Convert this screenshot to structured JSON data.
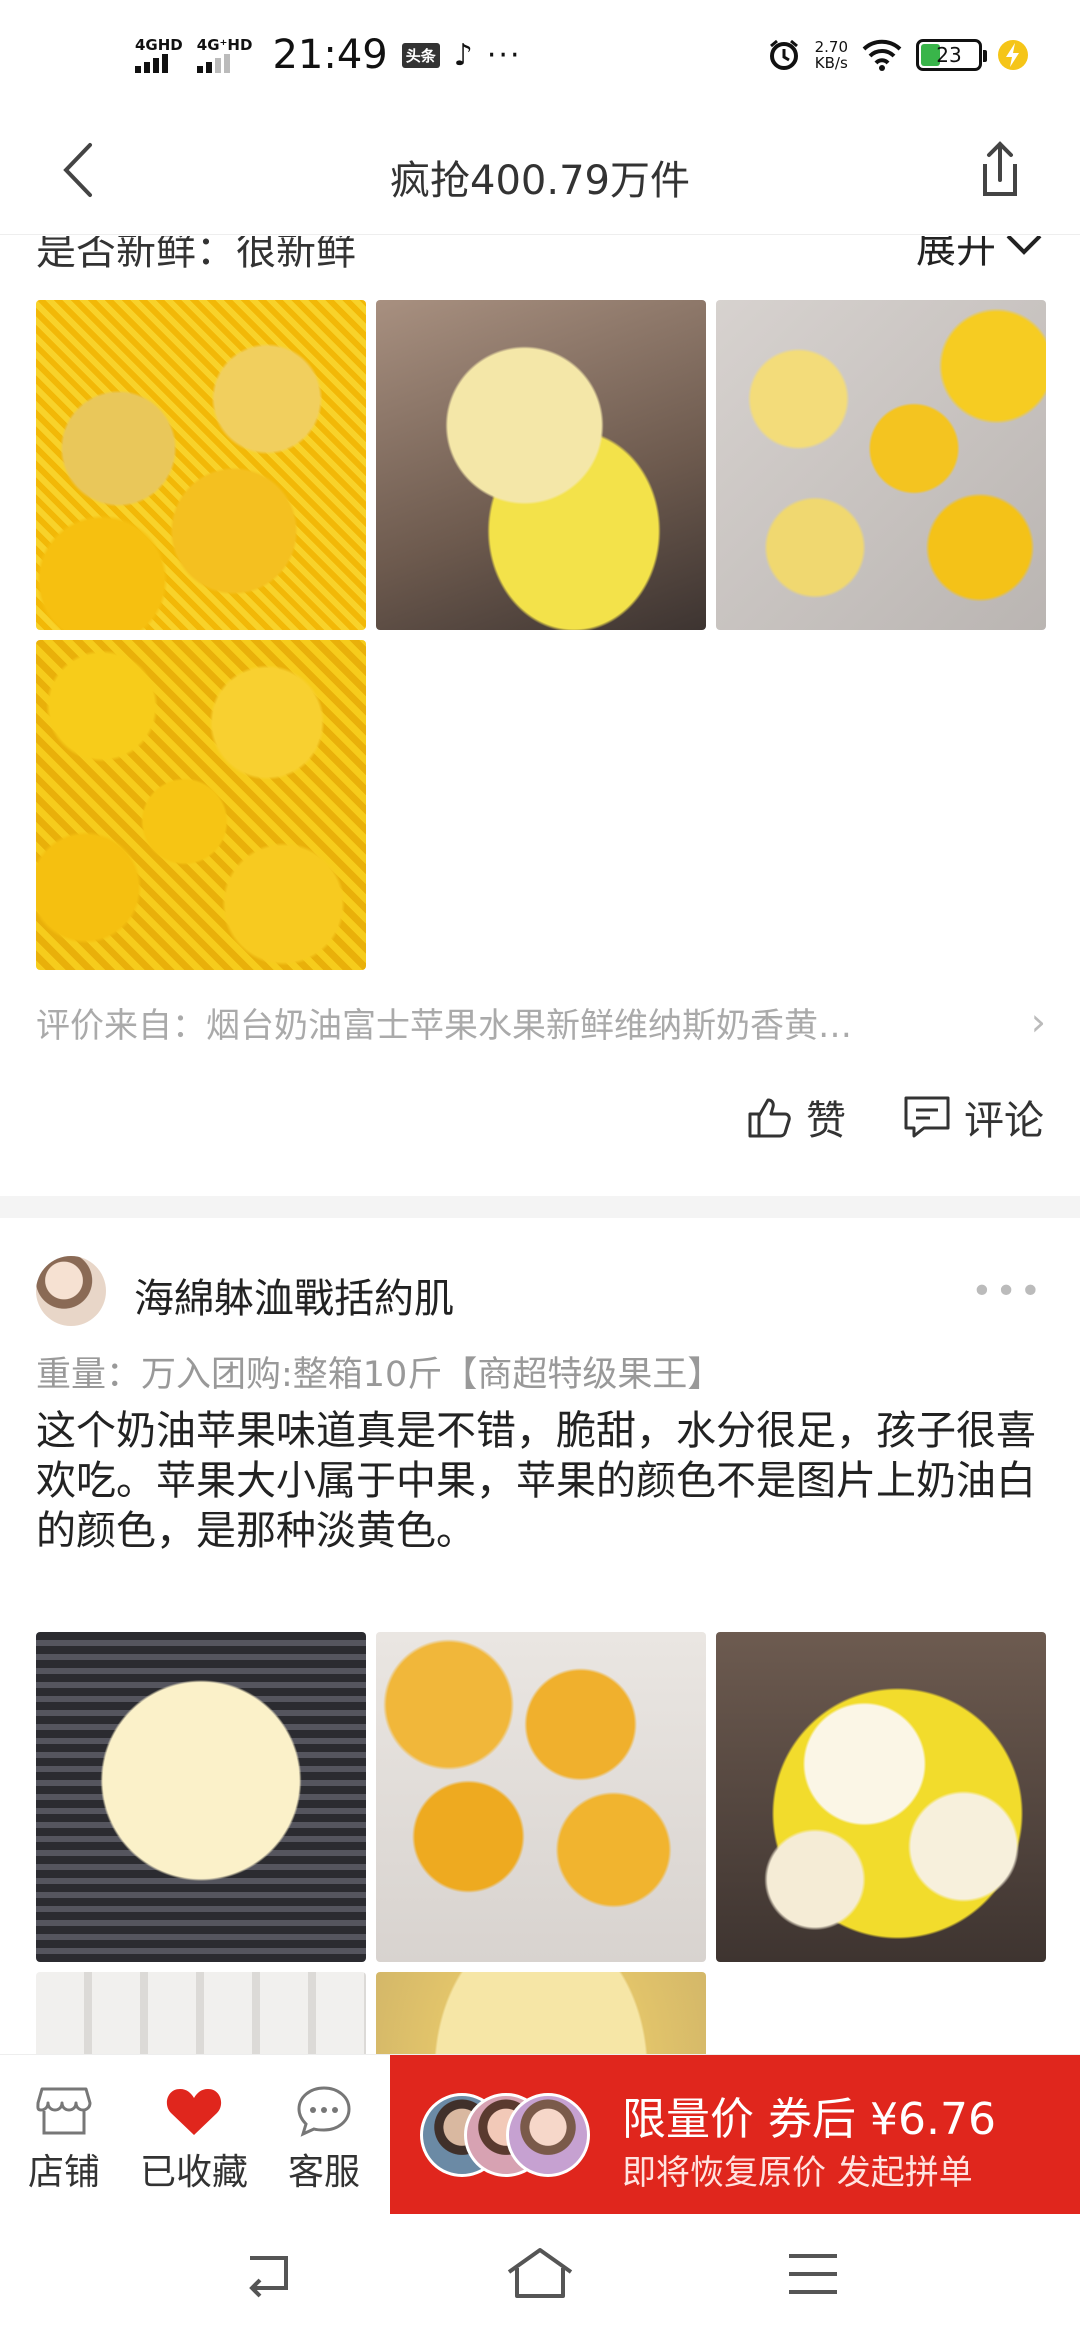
{
  "status_bar": {
    "sim1": "4GHD",
    "sim2": "4G⁺HD",
    "time": "21:49",
    "badge": "头条",
    "tiktok": "♪",
    "more": "···",
    "speed_value": "2.70",
    "speed_unit": "KB/s",
    "battery": "23"
  },
  "nav": {
    "title": "疯抢400.79万件"
  },
  "review1": {
    "partial_line": "是否新鲜：很新鲜",
    "expand_label": "展开",
    "source": "评价来自：烟台奶油富士苹果水果新鲜维纳斯奶香黄…",
    "like_label": "赞",
    "comment_label": "评论"
  },
  "review2": {
    "username": "海綿躰洫戰括約肌",
    "spec": "重量：万入团购:整箱10斤【商超特级果王】",
    "text": "这个奶油苹果味道真是不错，脆甜，水分很足，孩子很喜欢吃。苹果大小属于中果，苹果的颜色不是图片上奶油白的颜色，是那种淡黄色。"
  },
  "bottom_bar": {
    "shop_label": "店铺",
    "fav_label": "已收藏",
    "service_label": "客服",
    "cta_line1": "限量价  券后 ¥6.76",
    "cta_line2": "即将恢复原价  发起拼单"
  },
  "colors": {
    "accent_red": "#e0261d",
    "heart_red": "#e0261d",
    "fruit_yellow": "#f5c518"
  }
}
